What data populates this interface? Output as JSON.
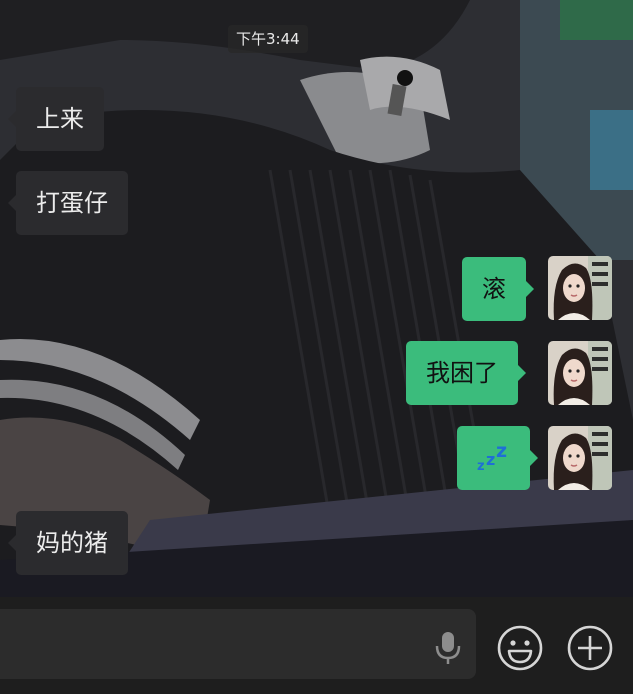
{
  "chat": {
    "timestamp": "下午3:44",
    "messages": [
      {
        "direction": "in",
        "text": "上来"
      },
      {
        "direction": "in",
        "text": "打蛋仔"
      },
      {
        "direction": "out",
        "text": "滚"
      },
      {
        "direction": "out",
        "text": "我困了"
      },
      {
        "direction": "out",
        "emoji": "zzz-sleeping"
      },
      {
        "direction": "in",
        "text": "妈的猪"
      }
    ],
    "sleep_emoji": {
      "big": "z",
      "mid": "z",
      "small": "z"
    }
  },
  "input_bar": {
    "text_value": "",
    "voice_icon": "microphone-icon",
    "emoji_icon": "smiley-face-icon",
    "more_icon": "plus-circle-icon"
  },
  "colors": {
    "outgoing_bubble": "#3bbc7c",
    "incoming_bubble": "#2b2b2e",
    "input_bar": "#1e1e1e"
  }
}
